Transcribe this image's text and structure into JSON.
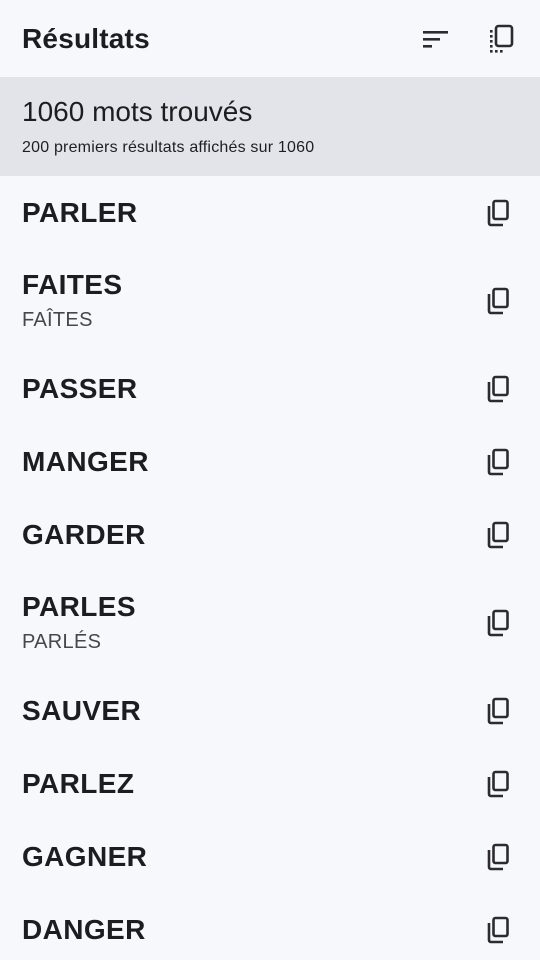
{
  "header": {
    "title": "Résultats",
    "sort_icon": "sort-icon",
    "copy_all_icon": "copy-all-icon"
  },
  "summary": {
    "title": "1060 mots trouvés",
    "subtitle": "200 premiers résultats affichés sur 1060"
  },
  "results": [
    {
      "word": "PARLER",
      "variant": ""
    },
    {
      "word": "FAITES",
      "variant": "FAÎTES"
    },
    {
      "word": "PASSER",
      "variant": ""
    },
    {
      "word": "MANGER",
      "variant": ""
    },
    {
      "word": "GARDER",
      "variant": ""
    },
    {
      "word": "PARLES",
      "variant": "PARLÉS"
    },
    {
      "word": "SAUVER",
      "variant": ""
    },
    {
      "word": "PARLEZ",
      "variant": ""
    },
    {
      "word": "GAGNER",
      "variant": ""
    },
    {
      "word": "DANGER",
      "variant": ""
    }
  ],
  "colors": {
    "background": "#f7f8fc",
    "summary_background": "#e3e4e9",
    "text": "#1c1d20",
    "secondary_text": "#45474d"
  }
}
